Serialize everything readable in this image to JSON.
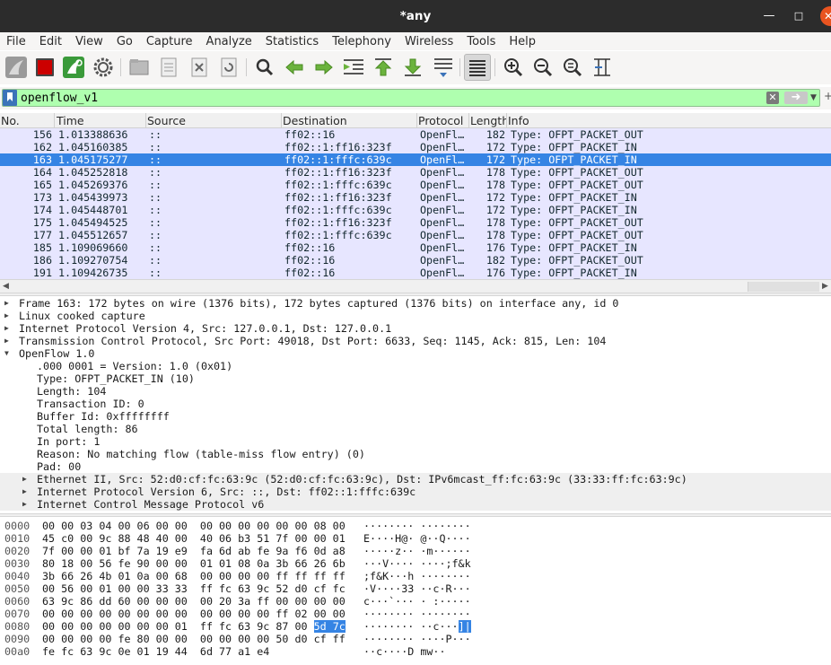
{
  "window": {
    "title": "*any"
  },
  "menu": [
    "File",
    "Edit",
    "View",
    "Go",
    "Capture",
    "Analyze",
    "Statistics",
    "Telephony",
    "Wireless",
    "Tools",
    "Help"
  ],
  "toolbar": {
    "buttons": [
      {
        "name": "shark-fin-start-icon"
      },
      {
        "name": "stop-capture-icon",
        "color": "#cc0000"
      },
      {
        "name": "restart-capture-icon",
        "color": "#3a9a3a"
      },
      {
        "name": "capture-options-gear-icon"
      },
      {
        "name": "open-file-icon"
      },
      {
        "name": "save-file-icon"
      },
      {
        "name": "close-file-icon"
      },
      {
        "name": "reload-file-icon"
      },
      {
        "name": "find-packet-icon"
      },
      {
        "name": "go-back-icon",
        "color": "#5aa02c"
      },
      {
        "name": "go-forward-icon",
        "color": "#5aa02c"
      },
      {
        "name": "go-to-packet-icon"
      },
      {
        "name": "first-packet-icon",
        "color": "#5aa02c"
      },
      {
        "name": "last-packet-icon",
        "color": "#5aa02c"
      },
      {
        "name": "auto-scroll-icon"
      },
      {
        "name": "colorize-icon"
      },
      {
        "name": "zoom-in-icon"
      },
      {
        "name": "zoom-out-icon"
      },
      {
        "name": "normal-size-icon"
      },
      {
        "name": "resize-columns-icon"
      }
    ]
  },
  "filter": {
    "value": "openflow_v1",
    "background": "#afffaf"
  },
  "packet_list": {
    "columns": [
      "No.",
      "Time",
      "Source",
      "Destination",
      "Protocol",
      "Length",
      "Info"
    ],
    "selected_index": 2,
    "row_color": "#e7e6ff",
    "selected_color": "#3584e4",
    "rows": [
      {
        "no": "156",
        "time": "1.013388636",
        "src": "::",
        "dst": "ff02::16",
        "proto": "OpenFl…",
        "len": "182",
        "info": "Type: OFPT_PACKET_OUT"
      },
      {
        "no": "162",
        "time": "1.045160385",
        "src": "::",
        "dst": "ff02::1:ff16:323f",
        "proto": "OpenFl…",
        "len": "172",
        "info": "Type: OFPT_PACKET_IN"
      },
      {
        "no": "163",
        "time": "1.045175277",
        "src": "::",
        "dst": "ff02::1:fffc:639c",
        "proto": "OpenFl…",
        "len": "172",
        "info": "Type: OFPT_PACKET_IN"
      },
      {
        "no": "164",
        "time": "1.045252818",
        "src": "::",
        "dst": "ff02::1:ff16:323f",
        "proto": "OpenFl…",
        "len": "178",
        "info": "Type: OFPT_PACKET_OUT"
      },
      {
        "no": "165",
        "time": "1.045269376",
        "src": "::",
        "dst": "ff02::1:fffc:639c",
        "proto": "OpenFl…",
        "len": "178",
        "info": "Type: OFPT_PACKET_OUT"
      },
      {
        "no": "173",
        "time": "1.045439973",
        "src": "::",
        "dst": "ff02::1:ff16:323f",
        "proto": "OpenFl…",
        "len": "172",
        "info": "Type: OFPT_PACKET_IN"
      },
      {
        "no": "174",
        "time": "1.045448701",
        "src": "::",
        "dst": "ff02::1:fffc:639c",
        "proto": "OpenFl…",
        "len": "172",
        "info": "Type: OFPT_PACKET_IN"
      },
      {
        "no": "175",
        "time": "1.045494525",
        "src": "::",
        "dst": "ff02::1:ff16:323f",
        "proto": "OpenFl…",
        "len": "178",
        "info": "Type: OFPT_PACKET_OUT"
      },
      {
        "no": "177",
        "time": "1.045512657",
        "src": "::",
        "dst": "ff02::1:fffc:639c",
        "proto": "OpenFl…",
        "len": "178",
        "info": "Type: OFPT_PACKET_OUT"
      },
      {
        "no": "185",
        "time": "1.109069660",
        "src": "::",
        "dst": "ff02::16",
        "proto": "OpenFl…",
        "len": "176",
        "info": "Type: OFPT_PACKET_IN"
      },
      {
        "no": "186",
        "time": "1.109270754",
        "src": "::",
        "dst": "ff02::16",
        "proto": "OpenFl…",
        "len": "182",
        "info": "Type: OFPT_PACKET_OUT"
      },
      {
        "no": "191",
        "time": "1.109426735",
        "src": "::",
        "dst": "ff02::16",
        "proto": "OpenFl…",
        "len": "176",
        "info": "Type: OFPT_PACKET_IN"
      }
    ]
  },
  "details": [
    {
      "level": 0,
      "toggle": "collapsed",
      "text": "Frame 163: 172 bytes on wire (1376 bits), 172 bytes captured (1376 bits) on interface any, id 0"
    },
    {
      "level": 0,
      "toggle": "collapsed",
      "text": "Linux cooked capture"
    },
    {
      "level": 0,
      "toggle": "collapsed",
      "text": "Internet Protocol Version 4, Src: 127.0.0.1, Dst: 127.0.0.1"
    },
    {
      "level": 0,
      "toggle": "collapsed",
      "text": "Transmission Control Protocol, Src Port: 49018, Dst Port: 6633, Seq: 1145, Ack: 815, Len: 104"
    },
    {
      "level": 0,
      "toggle": "expanded",
      "text": "OpenFlow 1.0"
    },
    {
      "level": 1,
      "toggle": "none",
      "text": ".000 0001 = Version: 1.0 (0x01)"
    },
    {
      "level": 1,
      "toggle": "none",
      "text": "Type: OFPT_PACKET_IN (10)"
    },
    {
      "level": 1,
      "toggle": "none",
      "text": "Length: 104"
    },
    {
      "level": 1,
      "toggle": "none",
      "text": "Transaction ID: 0"
    },
    {
      "level": 1,
      "toggle": "none",
      "text": "Buffer Id: 0xffffffff"
    },
    {
      "level": 1,
      "toggle": "none",
      "text": "Total length: 86"
    },
    {
      "level": 1,
      "toggle": "none",
      "text": "In port: 1"
    },
    {
      "level": 1,
      "toggle": "none",
      "text": "Reason: No matching flow (table-miss flow entry) (0)"
    },
    {
      "level": 1,
      "toggle": "none",
      "text": "Pad: 00"
    },
    {
      "level": 1,
      "toggle": "collapsed",
      "shaded": true,
      "text": "Ethernet II, Src: 52:d0:cf:fc:63:9c (52:d0:cf:fc:63:9c), Dst: IPv6mcast_ff:fc:63:9c (33:33:ff:fc:63:9c)"
    },
    {
      "level": 1,
      "toggle": "collapsed",
      "shaded": true,
      "text": "Internet Protocol Version 6, Src: ::, Dst: ff02::1:fffc:639c"
    },
    {
      "level": 1,
      "toggle": "collapsed",
      "shaded": true,
      "text": "Internet Control Message Protocol v6"
    }
  ],
  "hex": [
    {
      "offset": "0000",
      "bytes": "00 00 03 04 00 06 00 00  00 00 00 00 00 00 08 00",
      "ascii": "········ ········"
    },
    {
      "offset": "0010",
      "bytes": "45 c0 00 9c 88 48 40 00  40 06 b3 51 7f 00 00 01",
      "ascii": "E····H@· @··Q····"
    },
    {
      "offset": "0020",
      "bytes": "7f 00 00 01 bf 7a 19 e9  fa 6d ab fe 9a f6 0d a8",
      "ascii": "·····z·· ·m······"
    },
    {
      "offset": "0030",
      "bytes": "80 18 00 56 fe 90 00 00  01 01 08 0a 3b 66 26 6b",
      "ascii": "···V···· ····;f&k"
    },
    {
      "offset": "0040",
      "bytes": "3b 66 26 4b 01 0a 00 68  00 00 00 00 ff ff ff ff",
      "ascii": ";f&K···h ········"
    },
    {
      "offset": "0050",
      "bytes": "00 56 00 01 00 00 33 33  ff fc 63 9c 52 d0 cf fc",
      "ascii": "·V····33 ··c·R···"
    },
    {
      "offset": "0060",
      "bytes": "63 9c 86 dd 60 00 00 00  00 20 3a ff 00 00 00 00",
      "ascii": "c···`··· · :·····"
    },
    {
      "offset": "0070",
      "bytes": "00 00 00 00 00 00 00 00  00 00 00 00 ff 02 00 00",
      "ascii": "········ ········"
    },
    {
      "offset": "0080",
      "bytes_pre": "00 00 00 00 00 00 00 01  ff fc 63 9c 87 00 ",
      "bytes_hl": "5d 7c",
      "ascii_pre": "········ ··c···",
      "ascii_hl": "]|"
    },
    {
      "offset": "0090",
      "bytes": "00 00 00 00 fe 80 00 00  00 00 00 00 50 d0 cf ff",
      "ascii": "········ ····P···"
    },
    {
      "offset": "00a0",
      "bytes": "fe fc 63 9c 0e 01 19 44  6d 77 a1 e4",
      "ascii": "··c····D mw··"
    }
  ]
}
